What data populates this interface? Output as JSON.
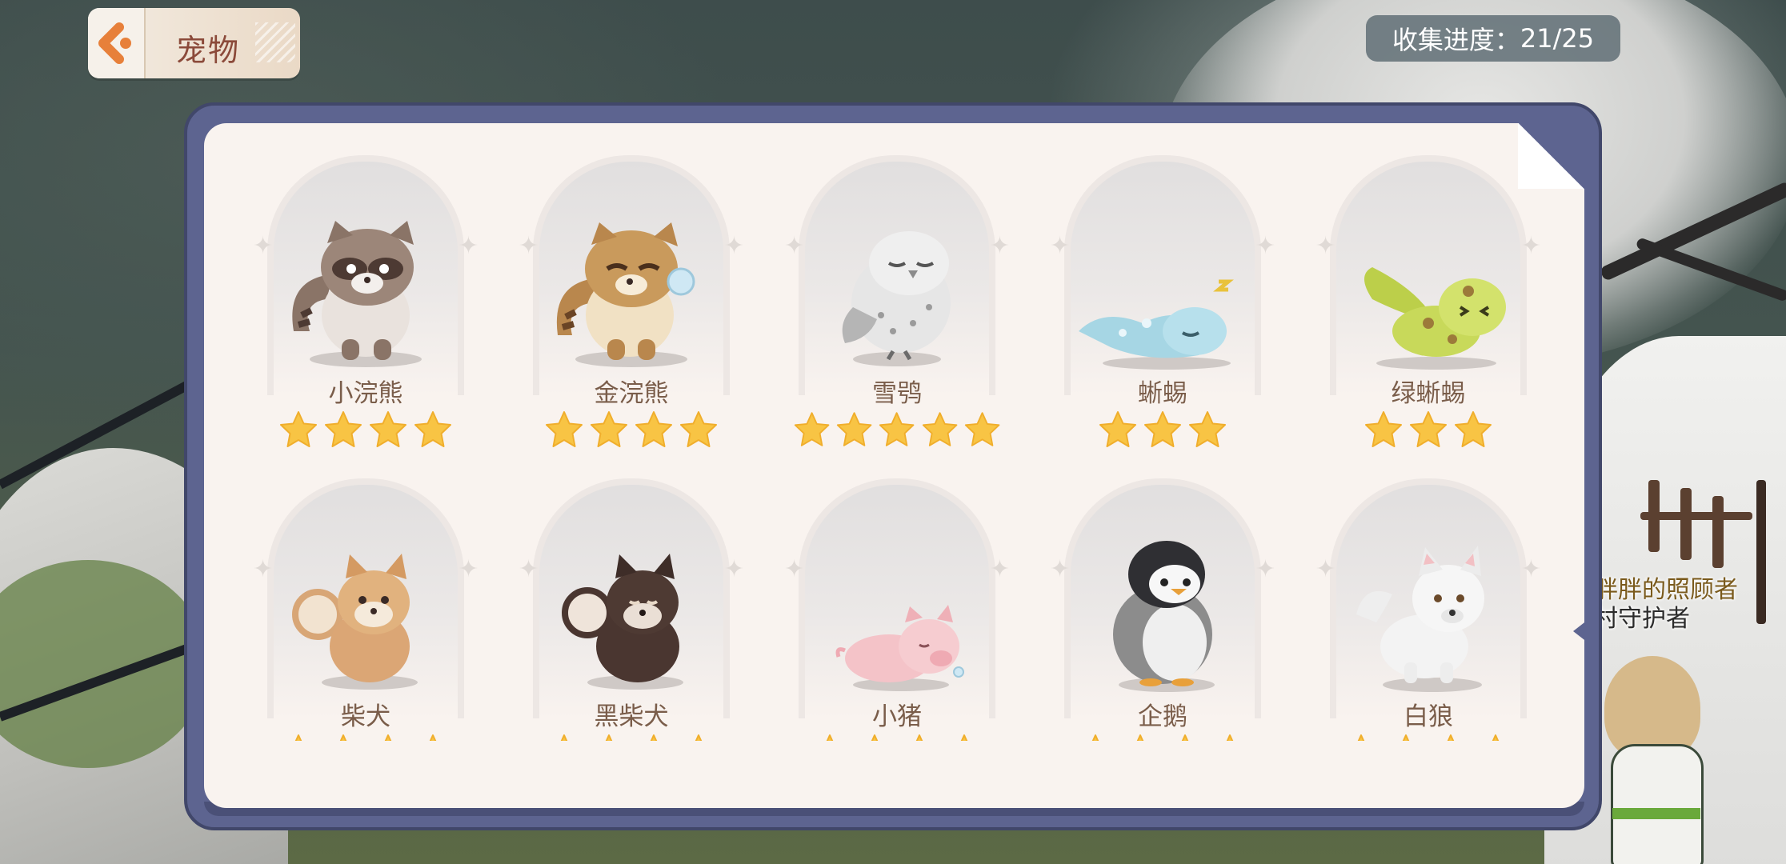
{
  "header": {
    "title": "宠物",
    "progress_label": "收集进度：",
    "progress_value": "21/25"
  },
  "npc": {
    "line1": "胖胖的照顾者",
    "line2": "村守护者"
  },
  "pets": [
    {
      "name": "小浣熊",
      "stars": 4,
      "art": "raccoon"
    },
    {
      "name": "金浣熊",
      "stars": 4,
      "art": "golden-raccoon"
    },
    {
      "name": "雪鸮",
      "stars": 5,
      "art": "snowy-owl"
    },
    {
      "name": "蜥蜴",
      "stars": 3,
      "art": "lizard"
    },
    {
      "name": "绿蜥蜴",
      "stars": 3,
      "art": "green-lizard"
    },
    {
      "name": "柴犬",
      "stars": null,
      "art": "shiba"
    },
    {
      "name": "黑柴犬",
      "stars": null,
      "art": "black-shiba"
    },
    {
      "name": "小猪",
      "stars": null,
      "art": "piglet"
    },
    {
      "name": "企鹅",
      "stars": null,
      "art": "penguin"
    },
    {
      "name": "白狼",
      "stars": null,
      "art": "white-wolf"
    }
  ],
  "colors": {
    "frame": "#5d6490",
    "panel": "#f9f3ef",
    "star": "#f8c444",
    "title_text": "#8b4a3a",
    "pet_name": "#7a5d4a"
  },
  "icons": {
    "back": "chevron-left-icon",
    "star": "star-icon"
  }
}
